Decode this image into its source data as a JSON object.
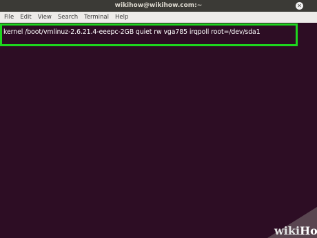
{
  "window": {
    "title": "wikihow@wikihow.com:~",
    "close_glyph": "✕"
  },
  "menubar": {
    "items": [
      "File",
      "Edit",
      "View",
      "Search",
      "Terminal",
      "Help"
    ]
  },
  "terminal": {
    "command_line": "kernel /boot/vmlinuz-2.6.21.4-eeepc-2GB quiet rw vga785 irqpoll root=/dev/sda1",
    "highlight_color": "#1ed51e",
    "background_color": "#2d0d24"
  },
  "watermark": {
    "brand_wiki": "wiki",
    "brand_how": "How"
  }
}
